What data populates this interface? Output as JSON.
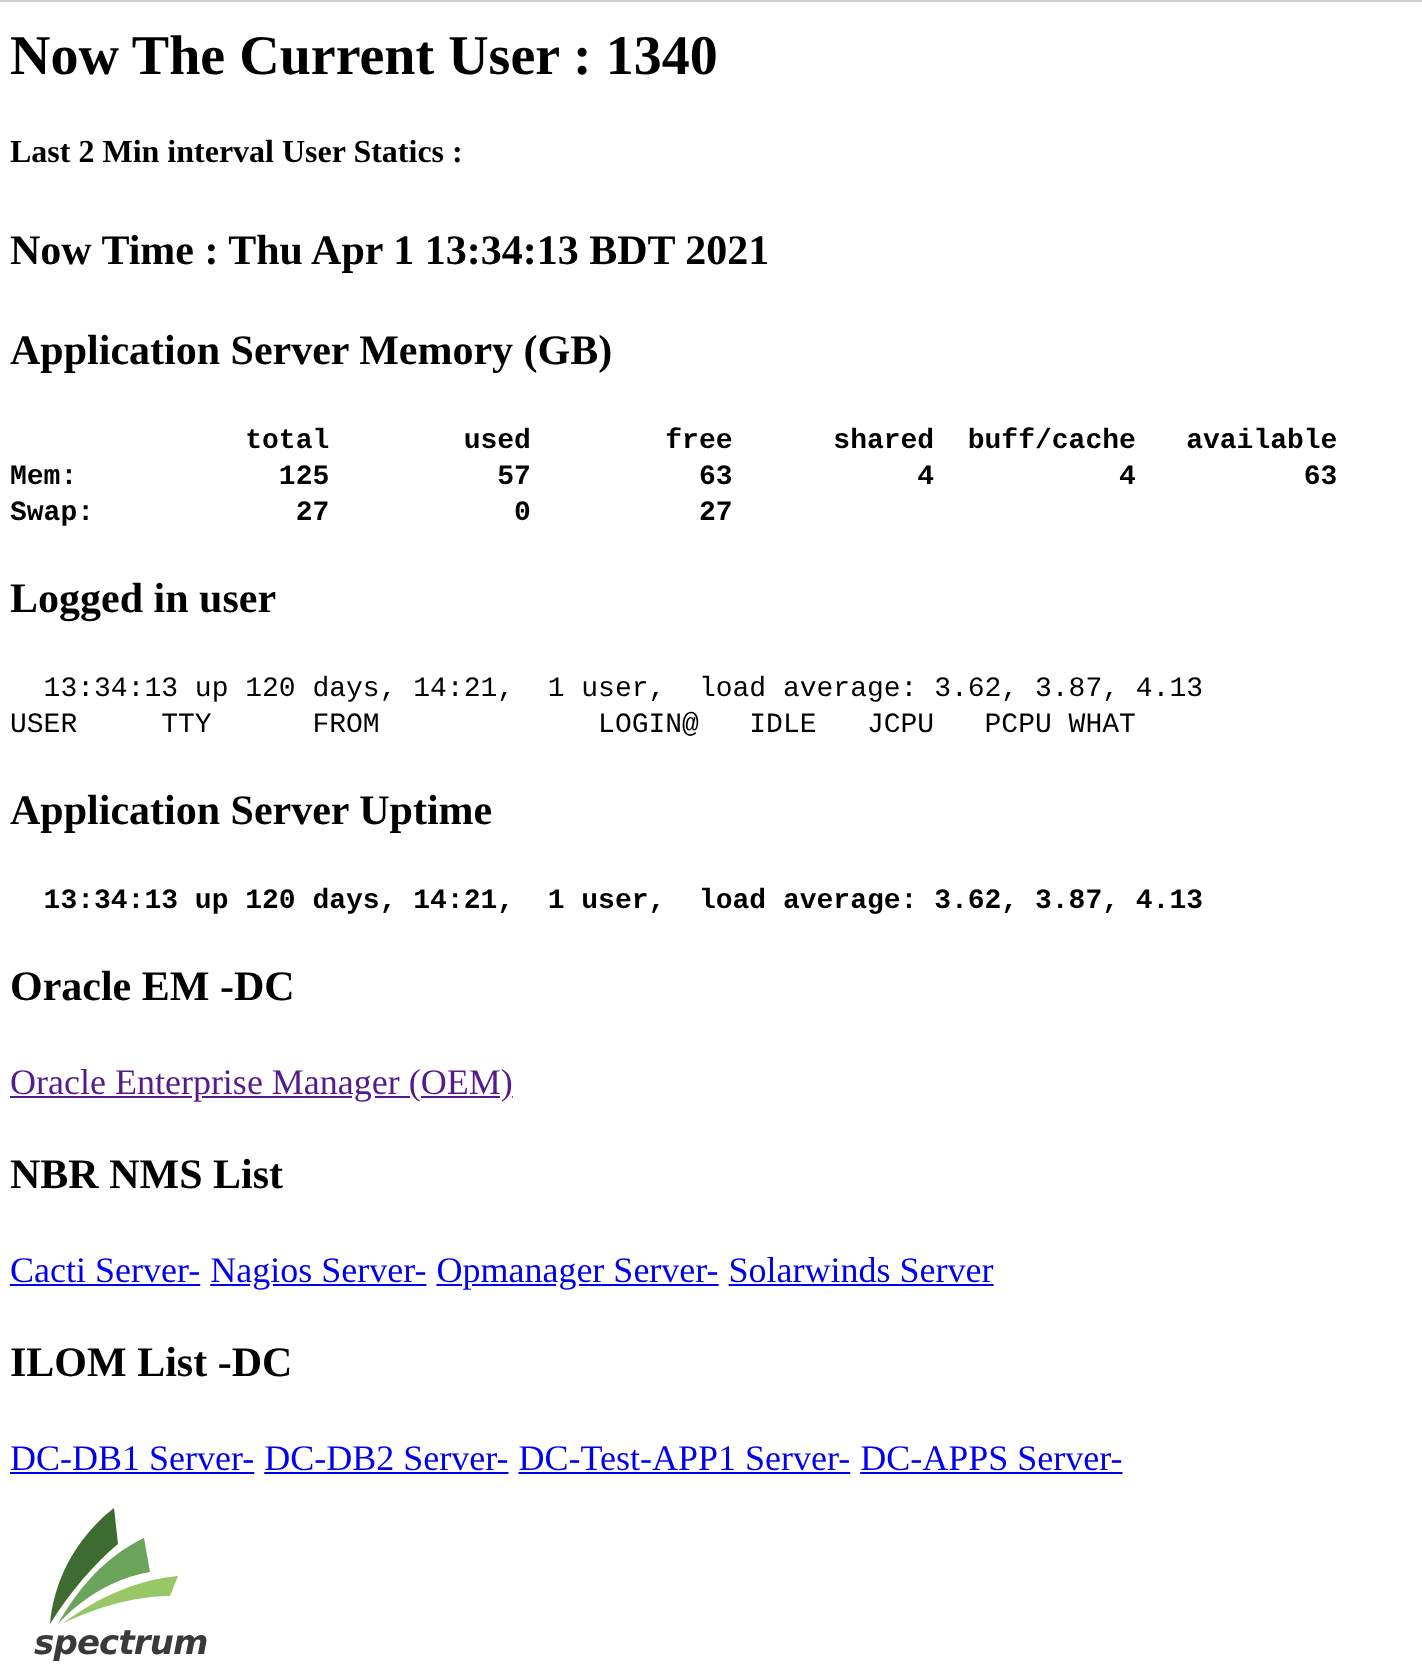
{
  "sections": [
    {
      "kind": "h1",
      "text": "Now The Current User : 1340"
    },
    {
      "kind": "h4",
      "text": "Last 2 Min interval User Statics :"
    },
    {
      "kind": "h2",
      "text": "Now Time : Thu Apr 1 13:34:13 BDT 2021"
    },
    {
      "kind": "h2",
      "text": "Application Server Memory (GB)"
    },
    {
      "kind": "pre",
      "bold": true,
      "lines": [
        "              total        used        free      shared  buff/cache   available",
        "Mem:            125          57          63           4           4          63",
        "Swap:            27           0          27"
      ]
    },
    {
      "kind": "h2",
      "text": "Logged in user"
    },
    {
      "kind": "pre",
      "bold": false,
      "lines": [
        "  13:34:13 up 120 days, 14:21,  1 user,  load average: 3.62, 3.87, 4.13",
        "USER     TTY      FROM             LOGIN@   IDLE   JCPU   PCPU WHAT"
      ]
    },
    {
      "kind": "h2",
      "text": "Application Server Uptime"
    },
    {
      "kind": "pre",
      "bold": true,
      "lines": [
        "  13:34:13 up 120 days, 14:21,  1 user,  load average: 3.62, 3.87, 4.13"
      ]
    },
    {
      "kind": "h2",
      "text": "Oracle EM -DC"
    },
    {
      "kind": "links",
      "links": [
        {
          "text": "Oracle Enterprise Manager (OEM)",
          "visited": true
        }
      ]
    },
    {
      "kind": "h2",
      "text": "NBR NMS List"
    },
    {
      "kind": "links",
      "links": [
        {
          "text": "Cacti Server-",
          "visited": false
        },
        {
          "text": "Nagios Server-",
          "visited": false
        },
        {
          "text": "Opmanager Server-",
          "visited": false
        },
        {
          "text": "Solarwinds Server",
          "visited": false
        }
      ]
    },
    {
      "kind": "h2",
      "text": "ILOM List -DC"
    },
    {
      "kind": "links",
      "links": [
        {
          "text": "DC-DB1 Server-",
          "visited": false
        },
        {
          "text": "DC-DB2 Server-",
          "visited": false
        },
        {
          "text": "DC-Test-APP1 Server-",
          "visited": false
        },
        {
          "text": "DC-APPS Server-",
          "visited": false
        }
      ]
    }
  ],
  "logo": {
    "wordmark": "spectrum"
  }
}
